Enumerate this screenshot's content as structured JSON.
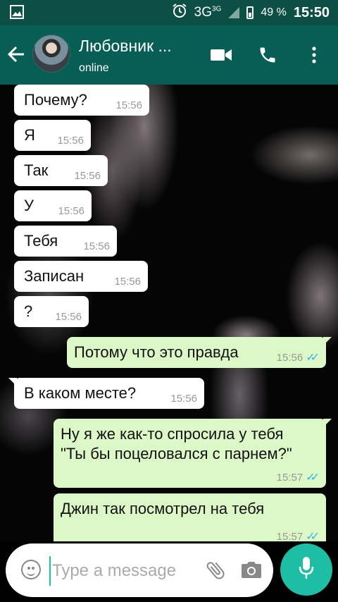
{
  "status_bar": {
    "network": "3G",
    "network_sup": "3G",
    "battery": "49 %",
    "time": "15:50"
  },
  "header": {
    "contact_name": "Любовник ...",
    "contact_status": "online"
  },
  "messages": [
    {
      "text": "Почему?",
      "time": "15:56",
      "direction": "in"
    },
    {
      "text": "Я",
      "time": "15:56",
      "direction": "in"
    },
    {
      "text": "Так",
      "time": "15:56",
      "direction": "in"
    },
    {
      "text": "У",
      "time": "15:56",
      "direction": "in"
    },
    {
      "text": "Тебя",
      "time": "15:56",
      "direction": "in"
    },
    {
      "text": "Записан",
      "time": "15:56",
      "direction": "in"
    },
    {
      "text": "?",
      "time": "15:56",
      "direction": "in"
    },
    {
      "text": "Потому что это правда",
      "time": "15:56",
      "direction": "out",
      "read": true
    },
    {
      "text": "В каком месте?",
      "time": "15:56",
      "direction": "in"
    },
    {
      "text": "Ну я же как-то спросила у тебя \"Ты бы поцеловался с парнем?\"",
      "time": "15:57",
      "direction": "out",
      "read": true
    },
    {
      "text": "Джин так посмотрел на тебя",
      "time": "15:57",
      "direction": "out",
      "read": true
    }
  ],
  "composer": {
    "placeholder": "Type a message"
  },
  "colors": {
    "header": "#075e54",
    "status_bar": "#0b4f45",
    "outgoing_bubble": "#dcf8c6",
    "incoming_bubble": "#ffffff",
    "fab": "#1ebea5",
    "read_check": "#34b7f1"
  },
  "icons": [
    "gallery-icon",
    "alarm-icon",
    "signal-icon",
    "battery-icon",
    "back-arrow-icon",
    "video-call-icon",
    "phone-icon",
    "more-icon",
    "emoji-icon",
    "attach-icon",
    "camera-icon",
    "mic-icon"
  ]
}
